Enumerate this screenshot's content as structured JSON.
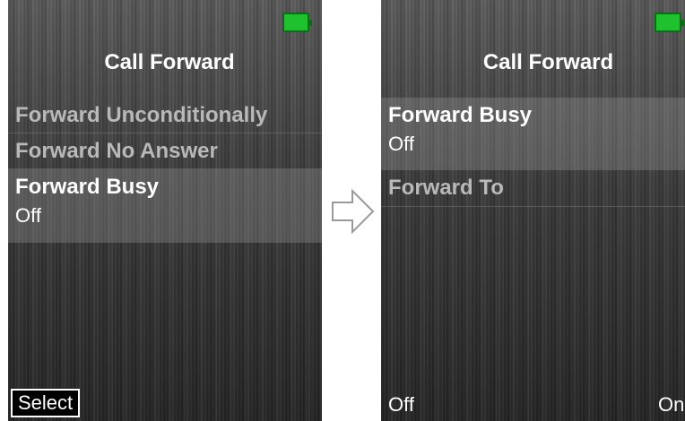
{
  "left_screen": {
    "title": "Call Forward",
    "menu_items": [
      {
        "label": "Forward Unconditionally"
      },
      {
        "label": "Forward No Answer"
      },
      {
        "label": "Forward Busy",
        "value": "Off"
      }
    ],
    "softkey_left": "Select"
  },
  "right_screen": {
    "title": "Call Forward",
    "menu_items": [
      {
        "label": "Forward Busy",
        "value": "Off"
      },
      {
        "label": "Forward To"
      }
    ],
    "softkey_left": "Off",
    "softkey_right": "On"
  },
  "icons": {
    "battery": "battery-icon",
    "transition": "arrow-right-icon"
  },
  "colors": {
    "battery_green": "#1fc12f",
    "selected_row": "#777777",
    "dim_text": "#b9b9b9"
  }
}
